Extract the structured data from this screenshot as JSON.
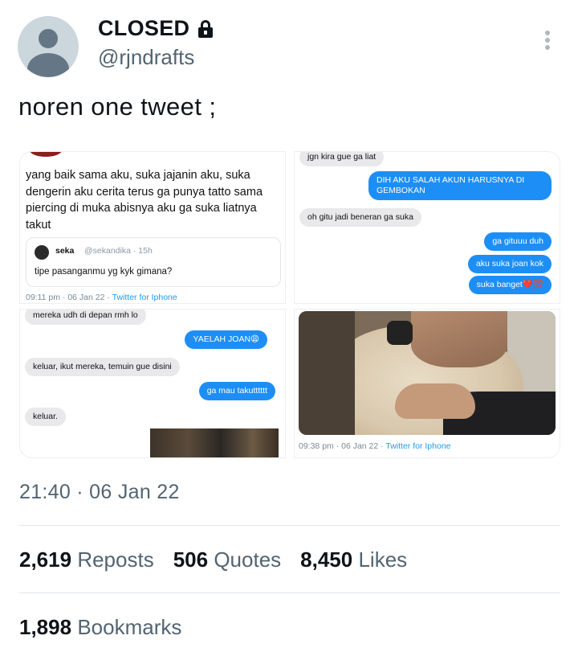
{
  "author": {
    "display_name": "CLOSED",
    "handle": "@rjndrafts",
    "protected_icon": "lock-icon"
  },
  "tweet": {
    "text": "noren one tweet ;"
  },
  "media": {
    "cell1": {
      "text": "yang baik sama aku, suka jajanin aku, suka dengerin aku cerita terus ga punya tatto sama piercing di muka abisnya aku ga suka liatnya takut",
      "quote_name": "seka",
      "quote_handle": "@sekandika · 15h",
      "quote_text": "tipe pasanganmu yg kyk gimana?",
      "meta_time": "09:11 pm · 06 Jan 22 · ",
      "meta_source": "Twitter for Iphone"
    },
    "cell2": {
      "msg1": "jgn kira gue ga liat",
      "msg2": "DIH AKU SALAH AKUN HARUSNYA DI GEMBOKAN",
      "msg3": "oh gitu jadi beneran ga suka",
      "msg4": "ga gituuu duh",
      "msg5": "aku suka joan kok",
      "msg6": "suka banget❤️💯"
    },
    "cell3": {
      "msg1": "mereka udh di depan rmh lo",
      "msg2": "YAELAH JOAN😩",
      "msg3": "keluar, ikut mereka, temuin gue disini",
      "msg4": "ga mau takutttttt",
      "msg5": "keluar."
    },
    "cell4": {
      "meta_time": "09:38 pm · 06 Jan 22 · ",
      "meta_source": "Twitter for Iphone"
    }
  },
  "timestamp": "21:40 · 06 Jan 22",
  "stats": {
    "reposts_count": "2,619",
    "reposts_label": "Reposts",
    "quotes_count": "506",
    "quotes_label": "Quotes",
    "likes_count": "8,450",
    "likes_label": "Likes",
    "bookmarks_count": "1,898",
    "bookmarks_label": "Bookmarks"
  },
  "colors": {
    "text_primary": "#0f1419",
    "text_secondary": "#536471",
    "link_blue": "#1d9bf0",
    "imessage_blue": "#1d8ef5"
  }
}
